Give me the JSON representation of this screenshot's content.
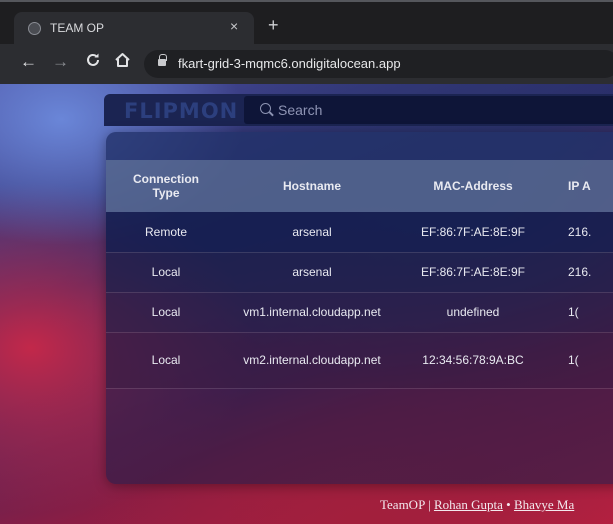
{
  "browser": {
    "tab_title": "TEAM OP",
    "tab_close": "×",
    "new_tab": "+",
    "url": "fkart-grid-3-mqmc6.ondigitalocean.app",
    "nav": {
      "back": "←",
      "forward": "→",
      "reload": "C",
      "home": "⌂"
    }
  },
  "header": {
    "logo": "FLIPMON",
    "search_placeholder": "Search"
  },
  "table": {
    "columns": [
      "Connection Type",
      "Hostname",
      "MAC-Address",
      "IP A"
    ],
    "rows": [
      {
        "type": "Remote",
        "hostname": "arsenal",
        "mac": "EF:86:7F:AE:8E:9F",
        "ip": "216."
      },
      {
        "type": "Local",
        "hostname": "arsenal",
        "mac": "EF:86:7F:AE:8E:9F",
        "ip": "216."
      },
      {
        "type": "Local",
        "hostname": "vm1.internal.cloudapp.net",
        "mac": "undefined",
        "ip": "1("
      },
      {
        "type": "Local",
        "hostname": "vm2.internal.cloudapp.net",
        "mac": "12:34:56:78:9A:BC",
        "ip": "1("
      }
    ]
  },
  "footer": {
    "team": "TeamOP | ",
    "author1": "Rohan Gupta",
    "separator": " • ",
    "author2": "Bhavye Ma"
  }
}
